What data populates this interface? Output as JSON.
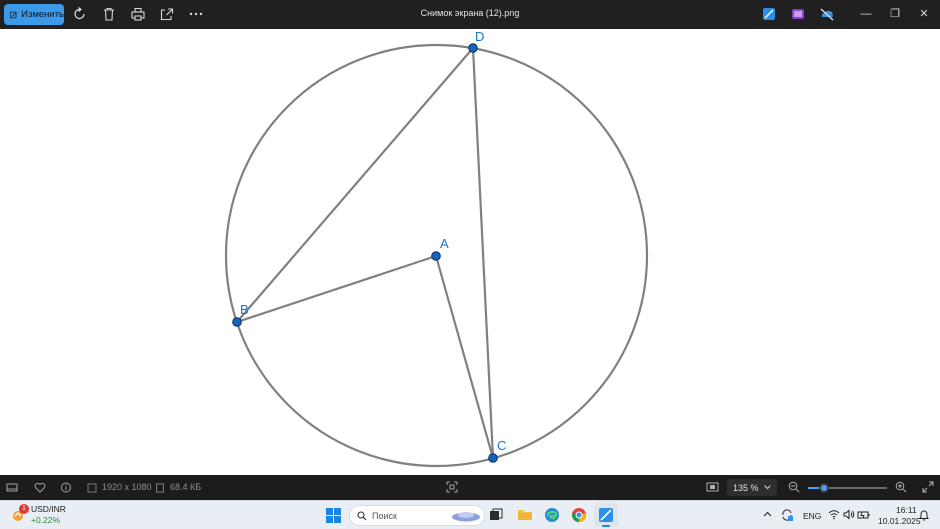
{
  "titlebar": {
    "edit_label": "Изменить",
    "file_title": "Снимок экрана (12).png",
    "tools": [
      "rotate-icon",
      "delete-icon",
      "print-icon",
      "share-icon",
      "more-icon"
    ],
    "extensions": [
      "image-editor-icon",
      "clipchamp-icon",
      "onedrive-icon"
    ]
  },
  "geometry": {
    "points": [
      {
        "label": "D"
      },
      {
        "label": "A"
      },
      {
        "label": "B"
      },
      {
        "label": "C"
      }
    ],
    "colors": {
      "circle": "#808080",
      "point_fill": "#1565c0",
      "label": "#1976d2"
    }
  },
  "status": {
    "dimensions": "1920 x 1080",
    "file_size": "68.4 КБ",
    "zoom": "135 %"
  },
  "taskbar": {
    "widget_name": "USD/INR",
    "widget_change": "+0.22%",
    "widget_badge": "1",
    "search_placeholder": "Поиск",
    "lang": "ENG",
    "time": "16:11",
    "date": "10.01.2025"
  }
}
